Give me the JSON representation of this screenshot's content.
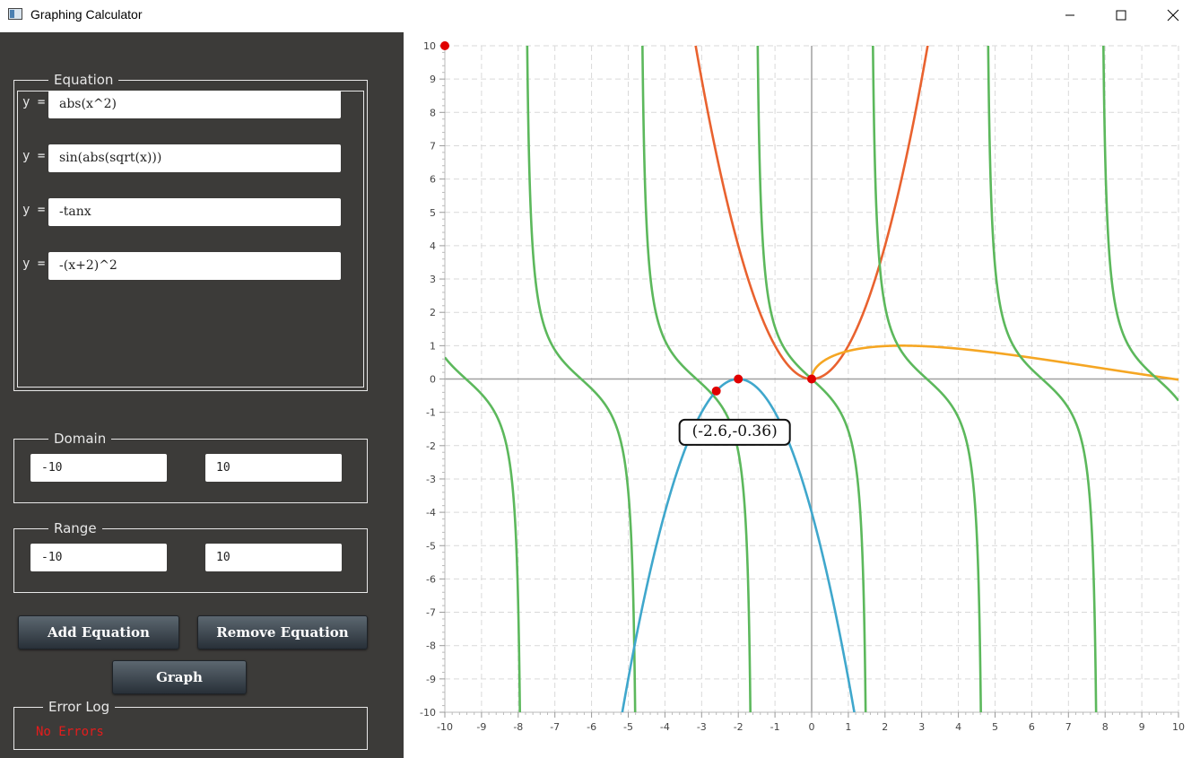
{
  "window": {
    "title": "Graphing Calculator"
  },
  "equations": {
    "group_label": "Equation",
    "prefix": "y =",
    "items": [
      {
        "value": "abs(x^2)",
        "color": "#e9622f"
      },
      {
        "value": "sin(abs(sqrt(x)))",
        "color": "#f5a623"
      },
      {
        "value": "-tanx",
        "color": "#5cb85c"
      },
      {
        "value": "-(x+2)^2",
        "color": "#3fa7cc"
      }
    ]
  },
  "domain": {
    "group_label": "Domain",
    "min": "-10",
    "max": "10"
  },
  "range": {
    "group_label": "Range",
    "min": "-10",
    "max": "10"
  },
  "buttons": {
    "add": "Add Equation",
    "remove": "Remove Equation",
    "graph": "Graph"
  },
  "error_log": {
    "group_label": "Error Log",
    "message": "No Errors"
  },
  "tooltip": {
    "text": "(-2.6,-0.36)"
  },
  "chart_data": {
    "type": "line",
    "xlim": [
      -10,
      10
    ],
    "ylim": [
      -10,
      10
    ],
    "x_ticks": [
      "-10",
      "-9",
      "-8",
      "-7",
      "-6",
      "-5",
      "-4",
      "-3",
      "-2",
      "-1",
      "0",
      "1",
      "2",
      "3",
      "4",
      "5",
      "6",
      "7",
      "8",
      "9",
      "10"
    ],
    "y_ticks": [
      "10",
      "9",
      "8",
      "7",
      "6",
      "5",
      "4",
      "3",
      "2",
      "1",
      "0",
      "-1",
      "-2",
      "-3",
      "-4",
      "-5",
      "-6",
      "-7",
      "-8",
      "-9",
      "-10"
    ],
    "grid": true,
    "series": [
      {
        "expr": "abs(x^2)",
        "color": "#e9622f"
      },
      {
        "expr": "sin(abs(sqrt(x)))",
        "color": "#f5a623"
      },
      {
        "expr": "-tanx",
        "color": "#5cb85c"
      },
      {
        "expr": "-(x+2)^2",
        "color": "#3fa7cc"
      }
    ],
    "points": [
      {
        "x": -10,
        "y": 10
      },
      {
        "x": -2.6,
        "y": -0.36
      },
      {
        "x": -2,
        "y": 0
      },
      {
        "x": 0,
        "y": 0
      }
    ],
    "point_color": "#e00000"
  }
}
